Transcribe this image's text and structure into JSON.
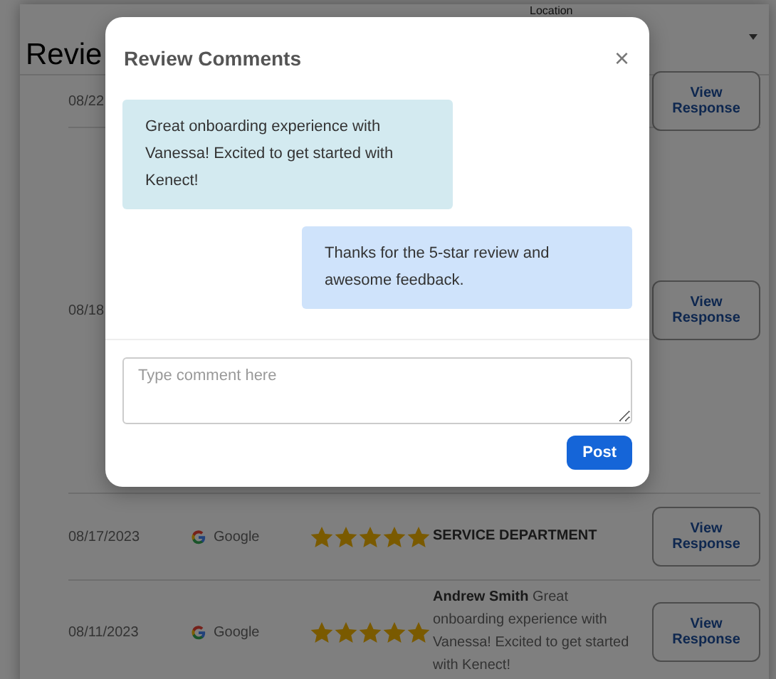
{
  "page": {
    "title": "Revie",
    "location_label": "Location"
  },
  "rows": [
    {
      "date": "08/22",
      "button": "View Response"
    },
    {
      "date": "08/18",
      "button": "View Response"
    },
    {
      "date": "08/17/2023",
      "source": "Google",
      "stars": 5,
      "review": "**SERVICE DEPARTMENT**",
      "button": "View Response"
    },
    {
      "date": "08/11/2023",
      "source": "Google",
      "stars": 5,
      "review": "**Andrew Smith** Great onboarding experience with Vanessa! Excited to get started with Kenect!",
      "button": "View Response"
    }
  ],
  "dialog": {
    "title": "Review Comments",
    "close": "×",
    "messages": [
      {
        "kind": "received",
        "text": "Great onboarding experience with Vanessa! Excited to get started with Kenect!"
      },
      {
        "kind": "sent",
        "text": "Thanks for the 5-star review and awesome feedback."
      }
    ],
    "comment": {
      "placeholder": "Type comment here"
    },
    "post_button": "Post"
  }
}
